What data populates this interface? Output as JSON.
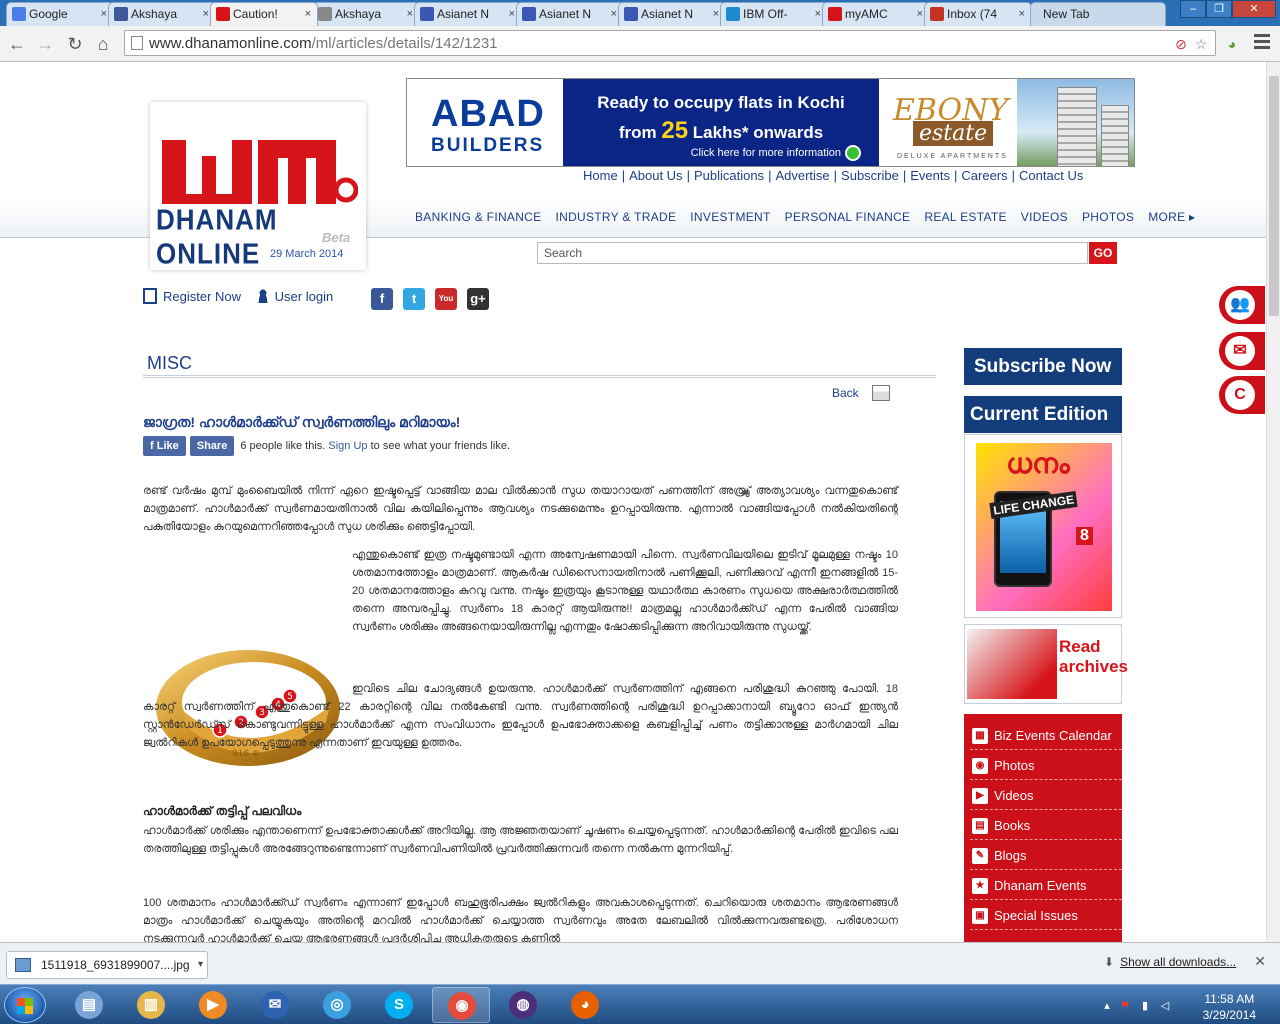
{
  "browser": {
    "tabs": [
      {
        "title": "Google",
        "icon": "google-icon",
        "color": "#4a7ee8"
      },
      {
        "title": "Akshaya",
        "icon": "facebook-icon",
        "color": "#3b5998"
      },
      {
        "title": "Caution!",
        "icon": "dhanam-icon",
        "color": "#d7141a"
      },
      {
        "title": "Akshaya",
        "icon": "page-icon",
        "color": "#888888"
      },
      {
        "title": "Asianet N",
        "icon": "asianet-icon",
        "color": "#3b57b6"
      },
      {
        "title": "Asianet N",
        "icon": "asianet-icon",
        "color": "#3b57b6"
      },
      {
        "title": "Asianet N",
        "icon": "asianet-icon",
        "color": "#3b57b6"
      },
      {
        "title": "IBM Off-",
        "icon": "ibm-icon",
        "color": "#1e8ad2"
      },
      {
        "title": "myAMC",
        "icon": "myamc-icon",
        "color": "#d7141a"
      },
      {
        "title": "Inbox (74",
        "icon": "gmail-icon",
        "color": "#c23321"
      }
    ],
    "new_tab_label": "New Tab",
    "url_domain": "www.dhanamonline.com",
    "url_path": "/ml/articles/details/142/1231"
  },
  "site": {
    "logo_text": "DHANAM ONLINE",
    "logo_beta": "Beta",
    "date": "29 March 2014",
    "banner": {
      "brand_line1": "ABAD",
      "brand_line2": "BUILDERS",
      "headline1": "Ready to occupy flats in Kochi",
      "headline2_pre": "from",
      "headline2_num": "25",
      "headline2_post": "Lakhs* onwards",
      "cta": "Click here for more information",
      "project1": "EBONY",
      "project2": "estate",
      "project3": "DELUXE APARTMENTS"
    },
    "top_links": [
      "Home",
      "About Us",
      "Publications",
      "Advertise",
      "Subscribe",
      "Events",
      "Careers",
      "Contact Us"
    ],
    "main_nav": [
      "BANKING & FINANCE",
      "INDUSTRY & TRADE",
      "INVESTMENT",
      "PERSONAL FINANCE",
      "REAL ESTATE",
      "VIDEOS",
      "PHOTOS",
      "MORE ▸"
    ],
    "search_placeholder": "Search",
    "search_button": "GO",
    "register_label": "Register Now",
    "login_label": "User login",
    "social": [
      {
        "name": "facebook",
        "glyph": "f",
        "color": "#3b5998"
      },
      {
        "name": "twitter",
        "glyph": "t",
        "color": "#32a6e0"
      },
      {
        "name": "youtube",
        "glyph": "You",
        "color": "#cc2a2a"
      },
      {
        "name": "google-plus",
        "glyph": "g+",
        "color": "#333333"
      }
    ]
  },
  "article": {
    "section": "MISC",
    "back_label": "Back",
    "title": "ജാഗ്രത! ഹാൾമാർക്ക്ഡ് സ്വർണത്തിലും മറിമായം!",
    "like_label": "Like",
    "share_label": "Share",
    "like_text_pre": "6 people like this.",
    "like_signup": "Sign Up",
    "like_text_post": "to see what your friends like.",
    "p1": "രണ്ട് വർഷം മുമ്പ് മുംബൈയിൽ നിന്ന് ഏറെ ഇഷ്ടപ്പെട്ട് വാങ്ങിയ മാല വിൽക്കാൻ സുധ തയാറായത് പണത്തിന് അത്ര്യ്ക്ക് അത്യാവശ്യം വന്നതുകൊണ്ട് മാത്രമാണ്. ഹാൾമാർക്ക് സ്വർണമായതിനാൽ വില കയിലിപ്പെന്നും ആവശ്യം നടക്കുമെന്നും ഉറപ്പായിരുന്നു. എന്നാൽ വാങ്ങിയപ്പോൾ നൽകിയതിന്റെ പകുതിയോളം കുറയുമെന്നറിഞ്ഞപ്പോൾ സുധ ശരിക്കും ഞെട്ടിപ്പോയി.",
    "p2": "എന്തുകൊണ്ട് ഇത്ര നഷ്ടമുണ്ടായി എന്ന അന്വേഷണമായി പിന്നെ. സ്വർണവിലയിലെ ഇടിവ് മൂലമുള്ള നഷ്ടം 10 ശതമാനത്തോളം മാത്രമാണ്. ആകർഷ ഡിസൈനായതിനാൽ പണിക്കൂലി, പണിക്കുറവ് എന്നീ ഇനങ്ങളിൽ 15-20 ശതമാനത്തോളം കുറവു വന്നു. നഷ്ടം ഇത്രയും കൂടാനുള്ള യഥാർത്ഥ കാരണം സുധയെ അക്ഷരാർത്ഥത്തിൽ തന്നെ അമ്പരപ്പിച്ചു. സ്വർണം 18 കാരറ്റ് ആയിരുന്നു!! മാത്രമല്ല ഹാൾമാർക്ക്ഡ് എന്ന പേരിൽ വാങ്ങിയ സ്വർണം ശരിക്കും അങ്ങനെയായിരുന്നില്ല എന്നതും ഷോക്കടിപ്പിക്കുന്ന അറിവായിരുന്നു സുധയ്ക്ക്.",
    "p3": "ഇവിടെ ചില ചോദ്യങ്ങൾ ഉയരുന്നു. ഹാൾമാർക്ക് സ്വർണത്തിന് എങ്ങനെ പരിശുദ്ധി കുറഞ്ഞു പോയി. 18 കാരറ്റ് സ്വർണത്തിന് എന്തുകൊണ്ട് 22 കാരറ്റിന്റെ വില നൽകേണ്ടി വന്നു. സ്വർണത്തിന്റെ പരിശുദ്ധി ഉറപ്പാക്കാനായി ബ്യൂറോ ഓഫ് ഇന്ത്യൻ സ്റ്റാൻഡേർഡ്സ് കൊണ്ടുവന്നിട്ടുള്ള ഹാൾമാർക്ക് എന്ന സംവിധാനം ഇപ്പോൾ ഉപഭോക്താക്കളെ കബളിപ്പിച്ച് പണം തട്ടിക്കാനുള്ള മാർഗമായി ചില ജ്വൽറികൾ ഉപയോഗപ്പെടുത്തുന്നു എന്നതാണ് ഇവയുള്ള ഉത്തരം.",
    "subhead": "ഹാൾമാർക്ക് തട്ടിപ്പ് പലവിധം",
    "p4": "ഹാൾമാർക്ക് ശരിക്കും എന്താണെന്ന് ഉപഭോക്താക്കൾക്ക് അറിയില്ല. ആ അജ്ഞതയാണ് ചൂഷണം ചെയ്യപ്പെടുന്നത്. ഹാൾമാർക്കിന്റെ പേരിൽ ഇവിടെ പല തരത്തിലുള്ള തട്ടിപ്പുകൾ അരങ്ങേറുന്നുണ്ടെന്നാണ് സ്വർണവിപണിയിൽ പ്രവർത്തിക്കുന്നവർ തന്നെ നൽകുന്ന മുന്നറിയിപ്പ്.",
    "p5": "100 ശതമാനം ഹാൾമാർക്ക്ഡ് സ്വർണം എന്നാണ് ഇപ്പോൾ ബഹുഭൂരിപക്ഷം ജ്വൽറികളും അവകാശപ്പെടുന്നത്. ചെറിയൊരു ശതമാനം ആഭരണങ്ങൾ മാത്രം ഹാൾമാർക്ക് ചെയ്യുകയും അതിന്റെ മറവിൽ ഹാൾമാർക്ക് ചെയ്യാത്ത സ്വർണവും അതേ ലേബലിൽ വിൽക്കുന്നവരുണ്ടത്രെ. പരിശോധന നടക്കുന്നവർ ഹാൾമാർക്ക് ചെയ്ത ആഭരണങ്ങൾ പ്രദർശിപ്പിച്ചു അധികൃതരുടെ കണ്ണിൽ",
    "ring_numbers": [
      "1",
      "2",
      "3",
      "4",
      "5"
    ],
    "ring_stamp": "916 ⊕"
  },
  "sidebar": {
    "subscribe_label": "Subscribe Now",
    "current_edition_label": "Current Edition",
    "cover_title": "ധനം",
    "cover_life": "LIFE CHANGE",
    "cover_number": "8",
    "archives_line1": "Read",
    "archives_line2": "archives",
    "links": [
      {
        "label": "Biz Events Calendar",
        "icon": "calendar-icon",
        "glyph": "▦"
      },
      {
        "label": "Photos",
        "icon": "camera-icon",
        "glyph": "◉"
      },
      {
        "label": "Videos",
        "icon": "video-icon",
        "glyph": "▶"
      },
      {
        "label": "Books",
        "icon": "book-icon",
        "glyph": "▤"
      },
      {
        "label": "Blogs",
        "icon": "chat-icon",
        "glyph": "✎"
      },
      {
        "label": "Dhanam Events",
        "icon": "trophy-icon",
        "glyph": "★"
      },
      {
        "label": "Special Issues",
        "icon": "document-icon",
        "glyph": "▣"
      }
    ]
  },
  "downloads": {
    "file_name": "1511918_6931899007....jpg",
    "show_all": "Show all downloads..."
  },
  "taskbar": {
    "apps": [
      {
        "name": "windows-explorer",
        "glyph": "▤",
        "color": "#7aa4d6"
      },
      {
        "name": "libraries",
        "glyph": "▥",
        "color": "#e6b64a"
      },
      {
        "name": "media-player",
        "glyph": "▶",
        "color": "#f08a24"
      },
      {
        "name": "thunderbird",
        "glyph": "✉",
        "color": "#2c62b0"
      },
      {
        "name": "safari",
        "glyph": "◎",
        "color": "#3aa0e0"
      },
      {
        "name": "skype",
        "glyph": "S",
        "color": "#00aff0"
      },
      {
        "name": "chrome",
        "glyph": "◉",
        "color": "#e54b3c"
      },
      {
        "name": "eclipse",
        "glyph": "◍",
        "color": "#4b2f7a"
      },
      {
        "name": "firefox",
        "glyph": "◕",
        "color": "#e66000"
      }
    ],
    "time": "11:58 AM",
    "date": "3/29/2014"
  }
}
